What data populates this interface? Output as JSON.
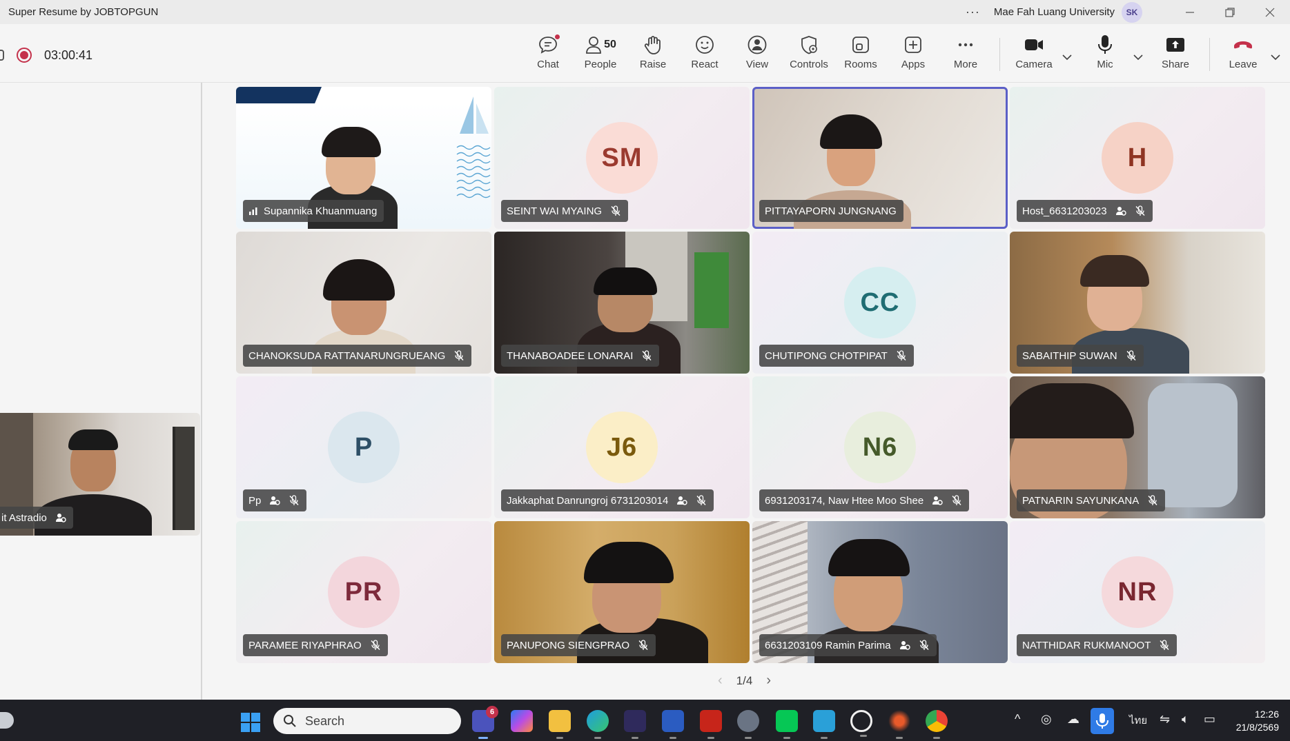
{
  "window": {
    "title": "Super Resume by JOBTOPGUN",
    "organization": "Mae Fah Luang University",
    "user_initials": "SK"
  },
  "recording": {
    "elapsed": "03:00:41"
  },
  "toolbar": {
    "chat": "Chat",
    "people": "People",
    "people_count": "50",
    "raise": "Raise",
    "react": "React",
    "view": "View",
    "controls": "Controls",
    "rooms": "Rooms",
    "apps": "Apps",
    "more": "More",
    "camera": "Camera",
    "mic": "Mic",
    "share": "Share",
    "leave": "Leave"
  },
  "self_view": {
    "name": "it Astradio"
  },
  "participants": [
    {
      "name": "Supannika Khuanmuang",
      "kind": "slide"
    },
    {
      "name": "SEINT WAI MYAING",
      "initials": "SM",
      "kind": "initials"
    },
    {
      "name": "PITTAYAPORN JUNGNANG",
      "kind": "video",
      "speaking": true
    },
    {
      "name": "Host_6631203023",
      "initials": "H",
      "kind": "initials"
    },
    {
      "name": "CHANOKSUDA RATTANARUNGRUEANG",
      "kind": "video"
    },
    {
      "name": "THANABOADEE LONARAI",
      "kind": "video"
    },
    {
      "name": "CHUTIPONG CHOTPIPAT",
      "initials": "CC",
      "kind": "initials"
    },
    {
      "name": "SABAITHIP SUWAN",
      "kind": "video"
    },
    {
      "name": "Pp",
      "initials": "P",
      "kind": "initials"
    },
    {
      "name": "Jakkaphat Danrungroj 6731203014",
      "initials": "J6",
      "kind": "initials"
    },
    {
      "name": "6931203174, Naw Htee Moo Shee",
      "initials": "N6",
      "kind": "initials"
    },
    {
      "name": "PATNARIN SAYUNKANA",
      "kind": "video"
    },
    {
      "name": "PARAMEE RIYAPHRAO",
      "initials": "PR",
      "kind": "initials"
    },
    {
      "name": "PANUPONG SIENGPRAO",
      "kind": "video"
    },
    {
      "name": "6631203109 Ramin Parima",
      "kind": "video"
    },
    {
      "name": "NATTHIDAR RUKMANOOT",
      "initials": "NR",
      "kind": "initials"
    }
  ],
  "pager": {
    "label": "1/4"
  },
  "taskbar": {
    "search_placeholder": "Search",
    "teams_badge": "6",
    "language": "ไทย",
    "time": "12:26",
    "date": "21/8/2569"
  },
  "colors": {
    "accent": "#5b5fc7",
    "recording": "#c4314b",
    "leave": "#c4314b",
    "taskbar": "#1f2026"
  },
  "icons": {
    "chat": "chat-icon",
    "people": "people-icon",
    "raise": "hand-icon",
    "react": "smiley-icon",
    "view": "view-icon",
    "controls": "shield-icon",
    "rooms": "rooms-icon",
    "apps": "apps-icon",
    "more": "ellipsis-icon",
    "camera": "camera-icon",
    "mic": "mic-icon",
    "share": "share-icon",
    "leave": "phone-hangup-icon"
  }
}
